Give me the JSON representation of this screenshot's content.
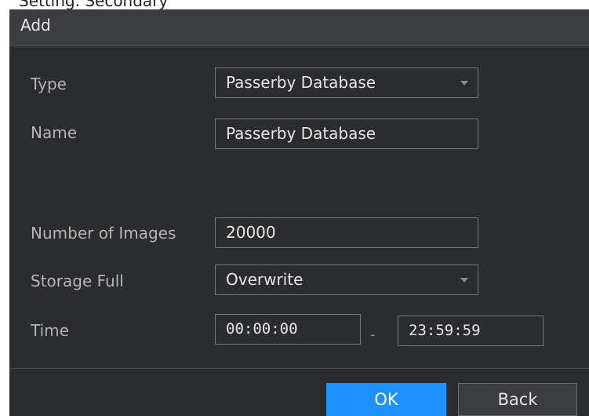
{
  "header_fragment": "Setting. Secondary",
  "dialog": {
    "title": "Add",
    "type": {
      "label": "Type",
      "value": "Passerby Database",
      "icon": "chevron-down-icon"
    },
    "name": {
      "label": "Name",
      "value": "Passerby Database"
    },
    "images": {
      "label": "Number of Images",
      "value": "20000"
    },
    "storage": {
      "label": "Storage Full",
      "value": "Overwrite",
      "icon": "chevron-down-icon"
    },
    "time": {
      "label": "Time",
      "start": "00:00:00",
      "separator": "-",
      "end": "23:59:59"
    },
    "buttons": {
      "ok": "OK",
      "back": "Back"
    }
  },
  "colors": {
    "dialog_bg": "#2b2c2e",
    "title_bg": "#3c3d40",
    "accent": "#1e90ff",
    "label_text": "#b4b4b4",
    "value_text": "#e6e6e6"
  }
}
